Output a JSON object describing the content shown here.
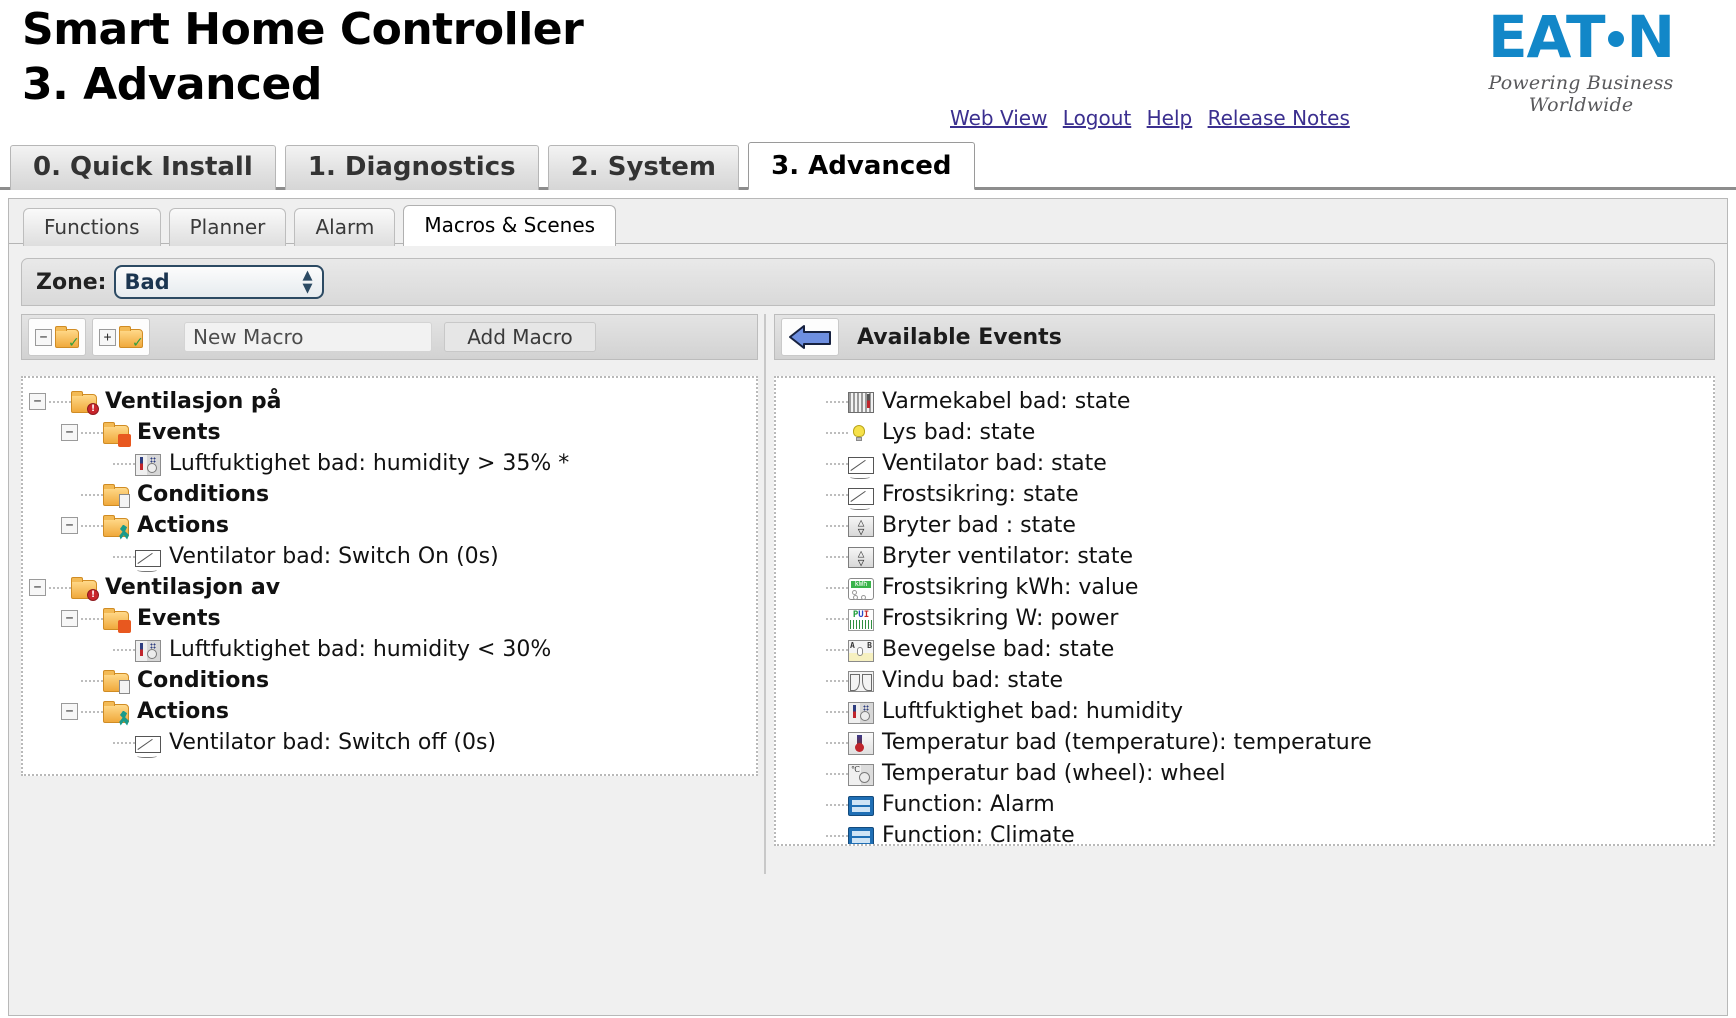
{
  "header": {
    "title_line1": "Smart Home Controller",
    "title_line2": "3. Advanced",
    "links": [
      {
        "label": "Web View",
        "name": "web-view-link"
      },
      {
        "label": "Logout",
        "name": "logout-link"
      },
      {
        "label": "Help",
        "name": "help-link"
      },
      {
        "label": "Release Notes",
        "name": "release-notes-link"
      }
    ],
    "logo": {
      "text_before_dot": "EAT",
      "text_after_dot": "N",
      "tagline": "Powering Business Worldwide",
      "color": "#1287c8"
    }
  },
  "main_tabs": [
    {
      "label": "0. Quick Install",
      "active": false
    },
    {
      "label": "1. Diagnostics",
      "active": false
    },
    {
      "label": "2. System",
      "active": false
    },
    {
      "label": "3. Advanced",
      "active": true
    }
  ],
  "sub_tabs": [
    {
      "label": "Functions",
      "active": false
    },
    {
      "label": "Planner",
      "active": false
    },
    {
      "label": "Alarm",
      "active": false
    },
    {
      "label": "Macros & Scenes",
      "active": true
    }
  ],
  "zone": {
    "label": "Zone:",
    "selected": "Bad",
    "options": [
      "Bad"
    ]
  },
  "toolbar": {
    "collapse_all_icon": "collapse-all-folder-icon",
    "expand_all_icon": "expand-all-folder-icon",
    "new_macro_placeholder": "New Macro",
    "add_macro_label": "Add Macro"
  },
  "available_panel": {
    "back_arrow_icon": "left-arrow-icon",
    "title": "Available Events"
  },
  "macro_tree": [
    {
      "indent": 1,
      "toggle": "minus",
      "icon": "folder-alert-icon",
      "label": "Ventilasjon på",
      "bold": true
    },
    {
      "indent": 2,
      "toggle": "minus",
      "icon": "folder-events-icon",
      "label": "Events",
      "bold": true
    },
    {
      "indent": 3,
      "toggle": "none",
      "icon": "humidity-sensor-icon",
      "label": "Luftfuktighet bad: humidity > 35% *",
      "bold": false
    },
    {
      "indent": 2,
      "toggle": "none",
      "icon": "folder-conditions-icon",
      "label": "Conditions",
      "bold": true
    },
    {
      "indent": 2,
      "toggle": "minus",
      "icon": "folder-actions-icon",
      "label": "Actions",
      "bold": true
    },
    {
      "indent": 3,
      "toggle": "none",
      "icon": "switch-icon",
      "label": "Ventilator bad: Switch On (0s)",
      "bold": false
    },
    {
      "indent": 1,
      "toggle": "minus",
      "icon": "folder-alert-icon",
      "label": "Ventilasjon av",
      "bold": true
    },
    {
      "indent": 2,
      "toggle": "minus",
      "icon": "folder-events-icon",
      "label": "Events",
      "bold": true
    },
    {
      "indent": 3,
      "toggle": "none",
      "icon": "humidity-sensor-icon",
      "label": "Luftfuktighet bad: humidity < 30%",
      "bold": false
    },
    {
      "indent": 2,
      "toggle": "none",
      "icon": "folder-conditions-icon",
      "label": "Conditions",
      "bold": true
    },
    {
      "indent": 2,
      "toggle": "minus",
      "icon": "folder-actions-icon",
      "label": "Actions",
      "bold": true
    },
    {
      "indent": 3,
      "toggle": "none",
      "icon": "switch-icon",
      "label": "Ventilator bad: Switch off (0s)",
      "bold": false
    }
  ],
  "available_events": [
    {
      "icon": "heating-cable-icon",
      "label": "Varmekabel bad: state"
    },
    {
      "icon": "lightbulb-icon",
      "label": "Lys bad: state"
    },
    {
      "icon": "switch-icon",
      "label": "Ventilator bad: state"
    },
    {
      "icon": "switch-icon",
      "label": "Frostsikring: state"
    },
    {
      "icon": "rocker-switch-icon",
      "label": "Bryter bad : state"
    },
    {
      "icon": "rocker-switch-icon",
      "label": "Bryter ventilator: state"
    },
    {
      "icon": "kwh-meter-icon",
      "label": "Frostsikring kWh: value"
    },
    {
      "icon": "power-meter-icon",
      "label": "Frostsikring W: power"
    },
    {
      "icon": "motion-sensor-icon",
      "label": "Bevegelse bad: state"
    },
    {
      "icon": "window-contact-icon",
      "label": "Vindu bad: state"
    },
    {
      "icon": "humidity-sensor-icon",
      "label": "Luftfuktighet bad: humidity"
    },
    {
      "icon": "thermometer-icon",
      "label": "Temperatur bad (temperature): temperature"
    },
    {
      "icon": "wheel-dial-icon",
      "label": "Temperatur bad (wheel): wheel"
    },
    {
      "icon": "function-icon",
      "label": "Function: Alarm"
    },
    {
      "icon": "function-icon",
      "label": "Function: Climate"
    }
  ]
}
